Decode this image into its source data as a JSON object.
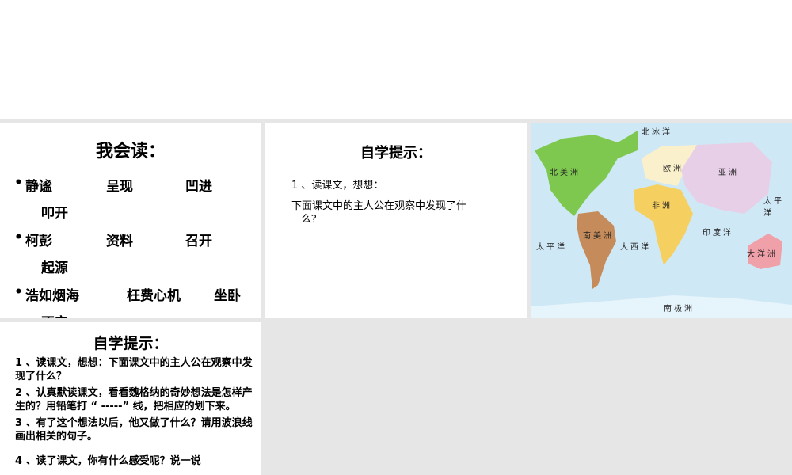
{
  "panel1": {
    "title": "我会读：",
    "rows": [
      {
        "words": [
          "静谧",
          "呈现",
          "凹进"
        ],
        "cont": "叩开"
      },
      {
        "words": [
          "柯彭",
          "资料",
          "召开"
        ],
        "cont": "起源"
      },
      {
        "words": [
          "浩如烟海",
          "枉费心机",
          "坐卧"
        ],
        "cont": "不安"
      }
    ]
  },
  "panel2": {
    "title": "自学提示：",
    "line1": "1 、读课文，想想：",
    "line2": "下面课文中的主人公在观察中发现了什",
    "line3": "么？"
  },
  "map": {
    "labels": {
      "arctic": "北冰洋",
      "north_america": "北美洲",
      "europe": "欧洲",
      "asia": "亚洲",
      "africa": "非洲",
      "pacific_east": "太平洋",
      "south_america": "南美洲",
      "pacific_west": "太平洋",
      "atlantic": "大西洋",
      "indian": "印度洋",
      "oceania": "大洋洲",
      "antarctica": "南极洲"
    }
  },
  "panel4": {
    "title": "自学提示：",
    "questions": [
      "1 、读课文，想想：下面课文中的主人公在观察中发现了什么？",
      "2 、认真默读课文，看看魏格纳的奇妙想法是怎样产生的？用铅笔打 “ -----” 线，把相应的划下来。",
      "3 、有了这个想法以后，他又做了什么？请用波浪线画出相关的句子。",
      "4 、读了课文，你有什么感受呢？说一说"
    ]
  }
}
